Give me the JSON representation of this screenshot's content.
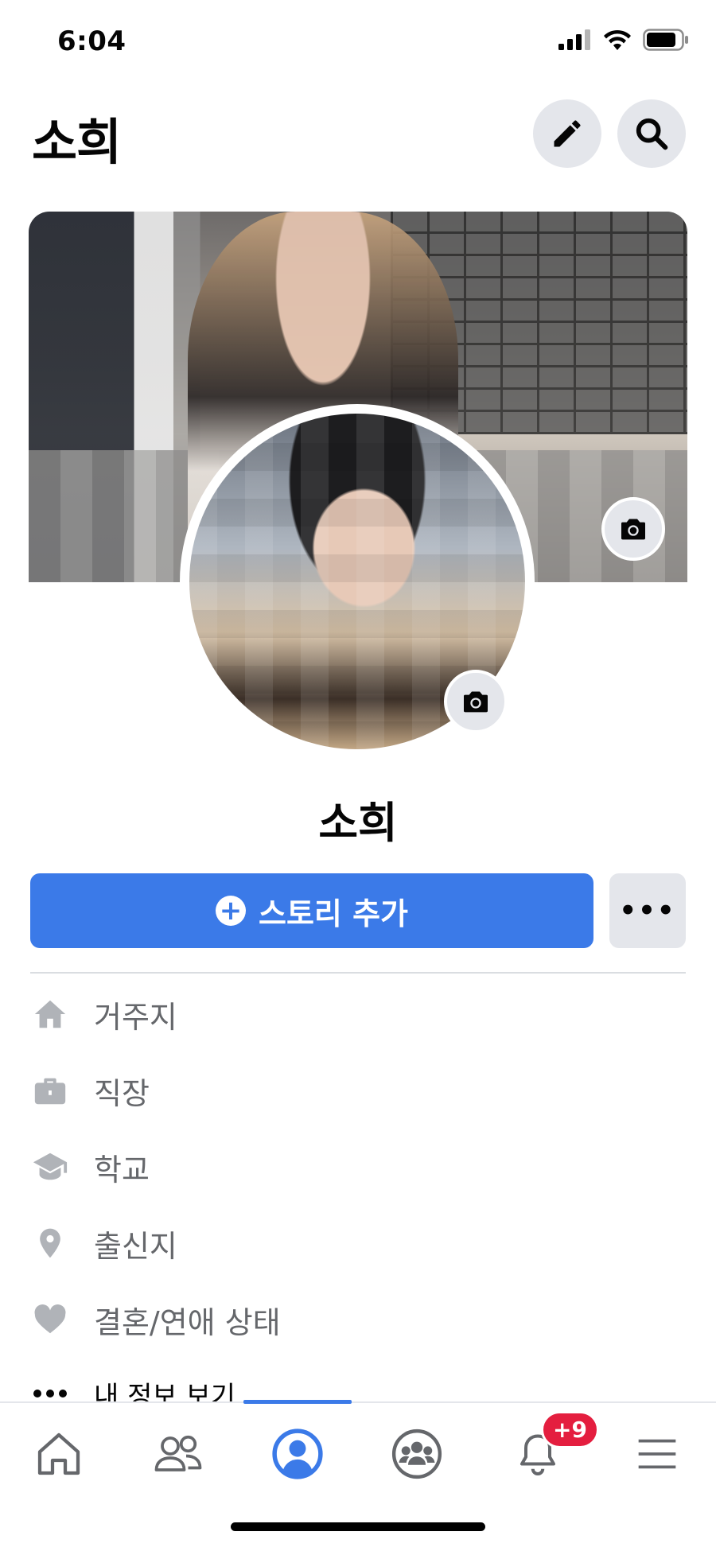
{
  "status_bar": {
    "time": "6:04"
  },
  "header": {
    "title": "소희"
  },
  "profile": {
    "name": "소희"
  },
  "actions": {
    "add_story_label": "스토리 추가",
    "more_label": "•••"
  },
  "info": {
    "items": [
      {
        "icon": "house-icon",
        "label": "거주지"
      },
      {
        "icon": "briefcase-icon",
        "label": "직장"
      },
      {
        "icon": "graduation-cap-icon",
        "label": "학교"
      },
      {
        "icon": "location-pin-icon",
        "label": "출신지"
      },
      {
        "icon": "heart-icon",
        "label": "결혼/연애 상태"
      }
    ],
    "see_about_label": "내 정보 보기"
  },
  "bottom_nav": {
    "items": [
      {
        "name": "home",
        "icon": "home-icon"
      },
      {
        "name": "friends",
        "icon": "friends-icon"
      },
      {
        "name": "profile",
        "icon": "profile-icon",
        "active": true
      },
      {
        "name": "groups",
        "icon": "groups-icon"
      },
      {
        "name": "notifications",
        "icon": "bell-icon",
        "badge": "+9"
      },
      {
        "name": "menu",
        "icon": "menu-icon"
      }
    ]
  },
  "colors": {
    "accent": "#3b7ae8",
    "badge": "#e41e3f",
    "icon_gray": "#b0b3b8"
  }
}
